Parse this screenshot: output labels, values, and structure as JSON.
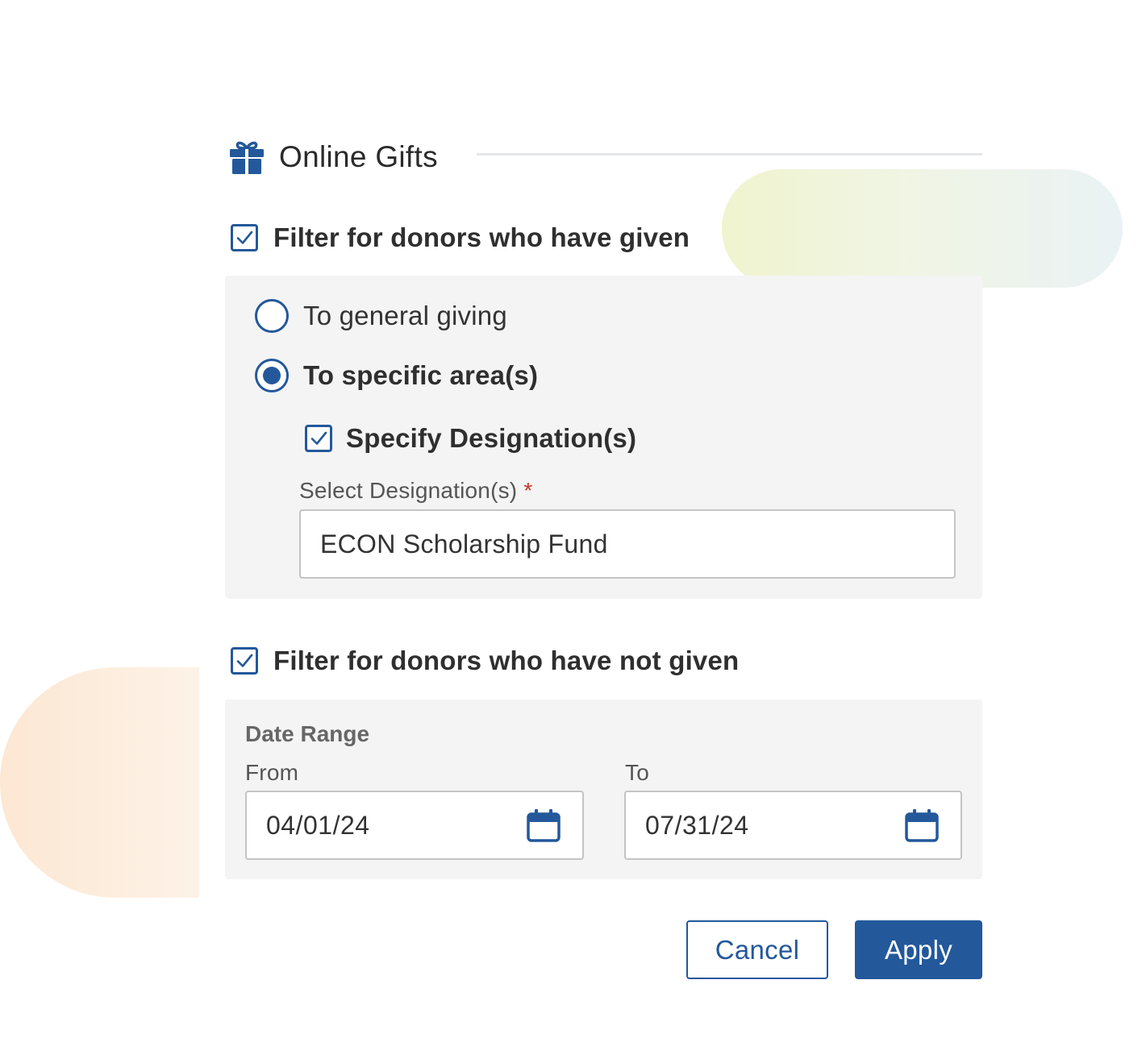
{
  "header": {
    "title": "Online Gifts",
    "icon": "gift-icon"
  },
  "filter_given": {
    "label": "Filter for donors who have given",
    "checked": true,
    "options": [
      {
        "label": "To general giving",
        "selected": false
      },
      {
        "label": "To specific area(s)",
        "selected": true
      }
    ],
    "specify_designations": {
      "label": "Specify Designation(s)",
      "checked": true
    },
    "designation_field": {
      "label": "Select Designation(s)",
      "required_mark": "*",
      "value": "ECON Scholarship Fund"
    }
  },
  "filter_not_given": {
    "label": "Filter for donors who have not given",
    "checked": true,
    "date_range": {
      "label": "Date Range",
      "from_label": "From",
      "from_value": "04/01/24",
      "to_label": "To",
      "to_value": "07/31/24",
      "icon": "calendar-icon"
    }
  },
  "actions": {
    "cancel_label": "Cancel",
    "apply_label": "Apply"
  },
  "colors": {
    "accent": "#23589b",
    "panel_bg": "#f4f4f4",
    "required": "#c0392b"
  }
}
